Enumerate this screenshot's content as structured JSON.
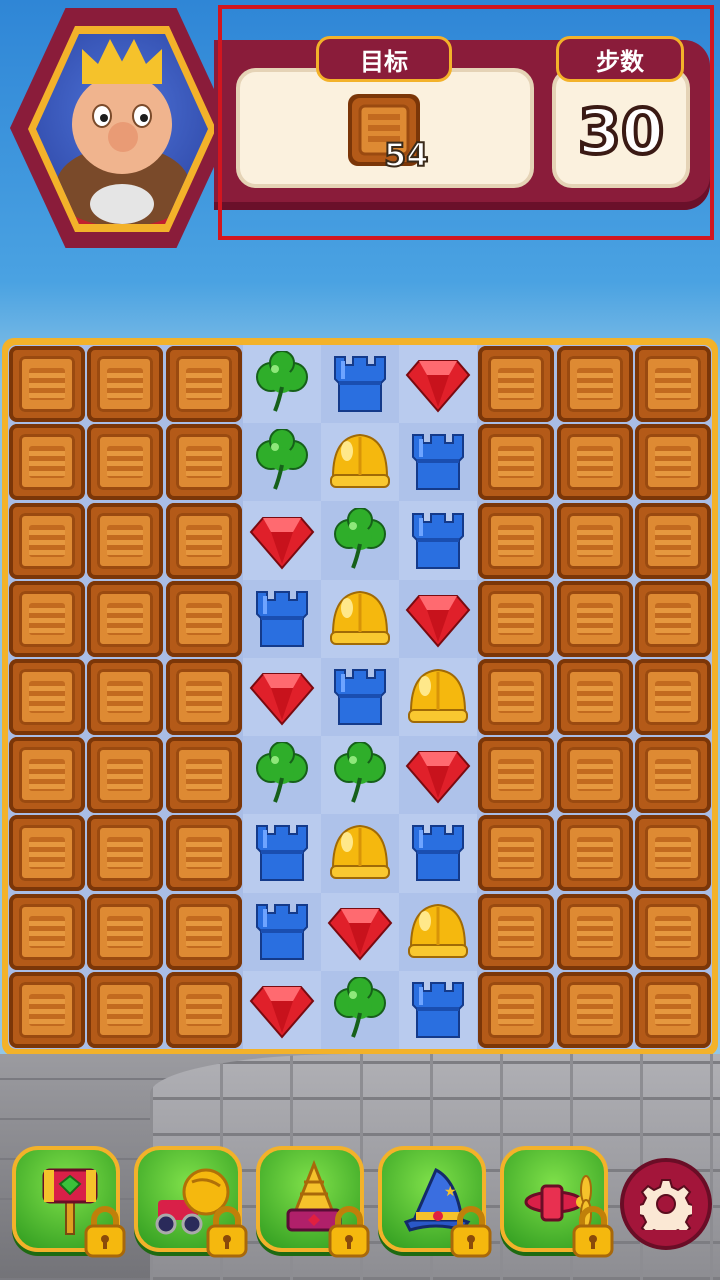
{
  "hud": {
    "goal_label": "目标",
    "moves_label": "步数",
    "goal_item": "wooden-crate",
    "goal_count": "54",
    "moves_count": "30"
  },
  "board": {
    "rows": 9,
    "cols": 9,
    "cells": [
      [
        "crate",
        "crate",
        "crate",
        "clover",
        "tower",
        "gem",
        "crate",
        "crate",
        "crate"
      ],
      [
        "crate",
        "crate",
        "crate",
        "clover",
        "helmet",
        "tower",
        "crate",
        "crate",
        "crate"
      ],
      [
        "crate",
        "crate",
        "crate",
        "gem",
        "clover",
        "tower",
        "crate",
        "crate",
        "crate"
      ],
      [
        "crate",
        "crate",
        "crate",
        "tower",
        "helmet",
        "gem",
        "crate",
        "crate",
        "crate"
      ],
      [
        "crate",
        "crate",
        "crate",
        "gem",
        "tower",
        "helmet",
        "crate",
        "crate",
        "crate"
      ],
      [
        "crate",
        "crate",
        "crate",
        "clover",
        "clover",
        "gem",
        "crate",
        "crate",
        "crate"
      ],
      [
        "crate",
        "crate",
        "crate",
        "tower",
        "helmet",
        "tower",
        "crate",
        "crate",
        "crate"
      ],
      [
        "crate",
        "crate",
        "crate",
        "tower",
        "gem",
        "helmet",
        "crate",
        "crate",
        "crate"
      ],
      [
        "crate",
        "crate",
        "crate",
        "gem",
        "clover",
        "tower",
        "crate",
        "crate",
        "crate"
      ]
    ]
  },
  "boosters": [
    {
      "name": "hammer",
      "locked": true
    },
    {
      "name": "boxing-glove",
      "locked": true
    },
    {
      "name": "cannon",
      "locked": true
    },
    {
      "name": "wizard-hat",
      "locked": true
    },
    {
      "name": "airplane",
      "locked": true
    }
  ],
  "colors": {
    "frame": "#8a1c3a",
    "gold": "#f3b22a",
    "panel": "#fbf1de",
    "clover": "#2fae2a",
    "tower": "#2a6fe0",
    "gem": "#e0202a",
    "helmet": "#f5b80e",
    "highlight": "#d2161f"
  }
}
